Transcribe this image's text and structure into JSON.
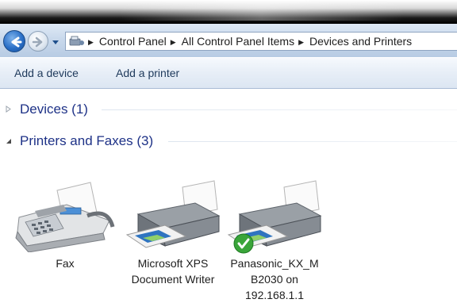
{
  "address_bar": {
    "crumbs": [
      "Control Panel",
      "All Control Panel Items",
      "Devices and Printers"
    ]
  },
  "toolbar": {
    "add_device": "Add a device",
    "add_printer": "Add a printer"
  },
  "groups": {
    "devices": {
      "title": "Devices (1)",
      "expanded": false
    },
    "printers": {
      "title": "Printers and Faxes (3)",
      "expanded": true
    }
  },
  "printers": [
    {
      "lines": [
        "Fax"
      ],
      "icon": "fax-machine-icon",
      "is_default": false
    },
    {
      "lines": [
        "Microsoft XPS",
        "Document Writer"
      ],
      "icon": "printer-icon",
      "is_default": false
    },
    {
      "lines": [
        "Panasonic_KX_M",
        "B2030 on",
        "192.168.1.1"
      ],
      "icon": "printer-icon",
      "is_default": true
    }
  ],
  "colors": {
    "group_header": "#1e3287",
    "command_text": "#1e395b",
    "default_check": "#3aa53a",
    "nav_back": "#2a6fc7"
  }
}
